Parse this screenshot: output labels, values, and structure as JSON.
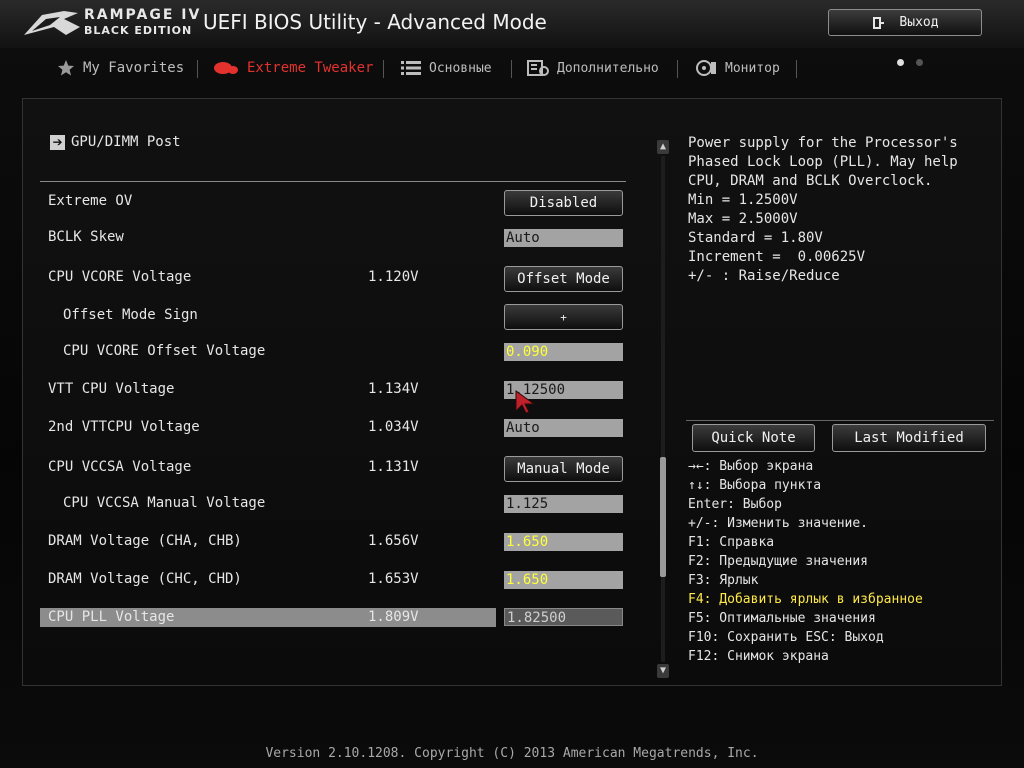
{
  "header": {
    "brand_line1": "RAMPAGE IV",
    "brand_line2": "BLACK EDITION",
    "title": "UEFI BIOS Utility - Advanced Mode",
    "exit_label": "Выход"
  },
  "nav": {
    "tabs": [
      {
        "label": "My Favorites",
        "icon": "star-icon"
      },
      {
        "label": "Extreme Tweaker",
        "icon": "tweaker-icon"
      },
      {
        "label": "Основные",
        "icon": "list-icon"
      },
      {
        "label": "Дополнительно",
        "icon": "advanced-icon"
      },
      {
        "label": "Монитор",
        "icon": "fan-monitor-icon"
      }
    ],
    "active_tab": "Extreme Tweaker"
  },
  "breadcrumb": "GPU/DIMM Post",
  "settings": [
    {
      "label": "Extreme OV",
      "current": "",
      "value": "Disabled",
      "kind": "button"
    },
    {
      "label": "BCLK Skew",
      "current": "",
      "value": "Auto",
      "kind": "field"
    },
    {
      "label": "CPU VCORE Voltage",
      "current": "1.120V",
      "value": "Offset Mode",
      "kind": "button"
    },
    {
      "label": "Offset Mode Sign",
      "current": "",
      "value": "+",
      "kind": "button"
    },
    {
      "label": "CPU VCORE Offset Voltage",
      "current": "",
      "value": "0.090",
      "kind": "field-yellow"
    },
    {
      "label": "VTT CPU Voltage",
      "current": "1.134V",
      "value": "1.12500",
      "kind": "field"
    },
    {
      "label": "2nd VTTCPU Voltage",
      "current": "1.034V",
      "value": "Auto",
      "kind": "field"
    },
    {
      "label": "CPU VCCSA Voltage",
      "current": "1.131V",
      "value": "Manual Mode",
      "kind": "button"
    },
    {
      "label": "CPU VCCSA Manual Voltage",
      "current": "",
      "value": "1.125",
      "kind": "field"
    },
    {
      "label": "DRAM Voltage (CHA, CHB)",
      "current": "1.656V",
      "value": "1.650",
      "kind": "field-yellow"
    },
    {
      "label": "DRAM Voltage (CHC, CHD)",
      "current": "1.653V",
      "value": "1.650",
      "kind": "field-yellow"
    },
    {
      "label": "CPU PLL Voltage",
      "current": "1.809V",
      "value": "1.82500",
      "kind": "field-selected"
    }
  ],
  "help": {
    "description": "Power supply for the Processor's\nPhased Lock Loop (PLL). May help\nCPU, DRAM and BCLK Overclock.\nMin = 1.2500V\nMax = 2.5000V\nStandard = 1.80V\nIncrement =  0.00625V\n+/- : Raise/Reduce",
    "quick_note": "Quick Note",
    "last_modified": "Last Modified",
    "keys": [
      "→←: Выбор экрана",
      "↑↓: Выбора пункта",
      "Enter: Выбор",
      "+/-: Изменить значение.",
      "F1: Справка",
      "F2: Предыдущие значения",
      "F3: Ярлык",
      "F4: Добавить ярлык в избранное",
      "F5: Оптимальные значения",
      "F10: Сохранить ESC: Выход",
      "F12: Снимок экрана"
    ],
    "highlighted_key": "F4: Добавить ярлык в избранное"
  },
  "footer": "Version 2.10.1208. Copyright (C) 2013 American Megatrends, Inc.",
  "colors": {
    "accent_red": "#e3322e",
    "value_yellow": "#ffff3a",
    "highlight_yellow": "#ffe94a"
  }
}
